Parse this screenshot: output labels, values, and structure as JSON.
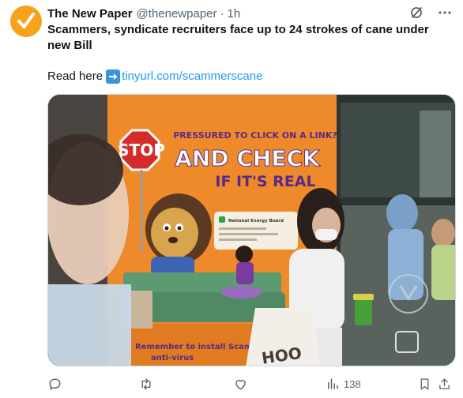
{
  "tweet": {
    "author": "The New Paper",
    "handle": "@thenewpaper",
    "separator": "·",
    "time": "1h",
    "headline": "Scammers, syndicate recruiters face up to 24 strokes of cane under new Bill",
    "read_here": "Read here",
    "link_text": "tinyurl.com/scammerscane"
  },
  "media": {
    "poster_kicker": "PRESSURED TO CLICK ON A LINK?",
    "poster_stop": "STOP",
    "poster_headline": "AND CHECK",
    "poster_subhead": "IF IT'S REAL",
    "phone_card_title": "National Energy Board",
    "poster_footer_line1": "Remember to install Scam",
    "poster_footer_line2": "anti-virus",
    "bag_text": "HOO"
  },
  "actions": {
    "views_count": "138"
  },
  "icons": {
    "avatar": "checkmark-logo-icon",
    "grok": "grok-icon",
    "more": "more-icon",
    "link_arrow": "right-arrow-emoji-icon",
    "reply": "reply-icon",
    "retweet": "retweet-icon",
    "like": "like-icon",
    "views": "views-icon",
    "bookmark": "bookmark-icon",
    "share": "share-icon"
  },
  "colors": {
    "link": "#1d9bf0",
    "secondary_text": "#536471",
    "avatar_bg": "#f7a21b",
    "poster_orange": "#ef8a2b",
    "poster_purple": "#5b2a86"
  }
}
